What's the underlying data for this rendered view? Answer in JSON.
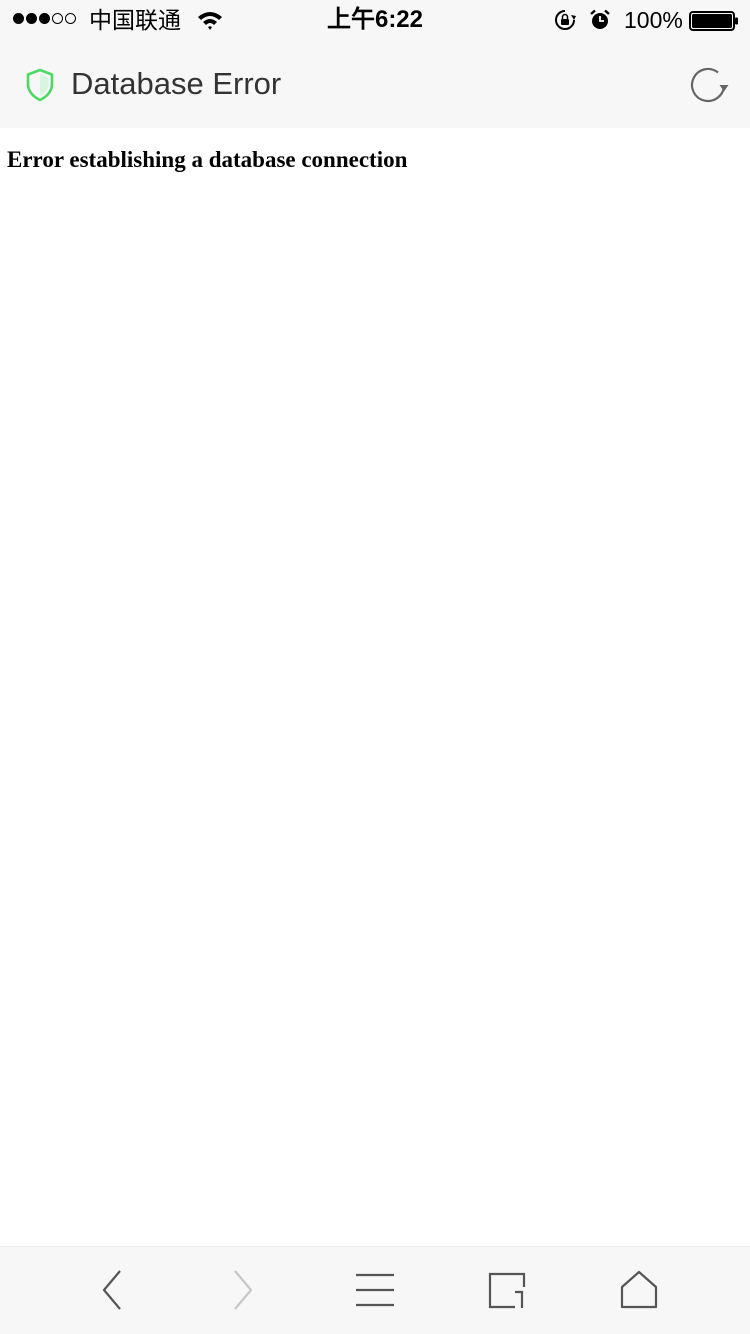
{
  "status_bar": {
    "signal_strength": 3,
    "signal_max": 5,
    "carrier": "中国联通",
    "time": "上午6:22",
    "battery_percent": "100%",
    "battery_level": 1.0,
    "icons": [
      "wifi-icon",
      "rotation-lock-icon",
      "alarm-icon",
      "battery-icon"
    ]
  },
  "title_bar": {
    "title": "Database Error",
    "security_icon": "shield-icon",
    "reload_icon": "reload-icon"
  },
  "page": {
    "heading": "Error establishing a database connection"
  },
  "toolbar": {
    "buttons": [
      {
        "icon": "back-icon",
        "enabled": true
      },
      {
        "icon": "forward-icon",
        "enabled": false
      },
      {
        "icon": "menu-icon",
        "enabled": true
      },
      {
        "icon": "tabs-icon",
        "enabled": true
      },
      {
        "icon": "home-icon",
        "enabled": true
      }
    ]
  },
  "colors": {
    "bar_background": "#f7f7f7",
    "shield_green": "#4cd964",
    "title_text": "#333333",
    "icon_gray": "#555555",
    "disabled_gray": "#c7c7c7"
  }
}
